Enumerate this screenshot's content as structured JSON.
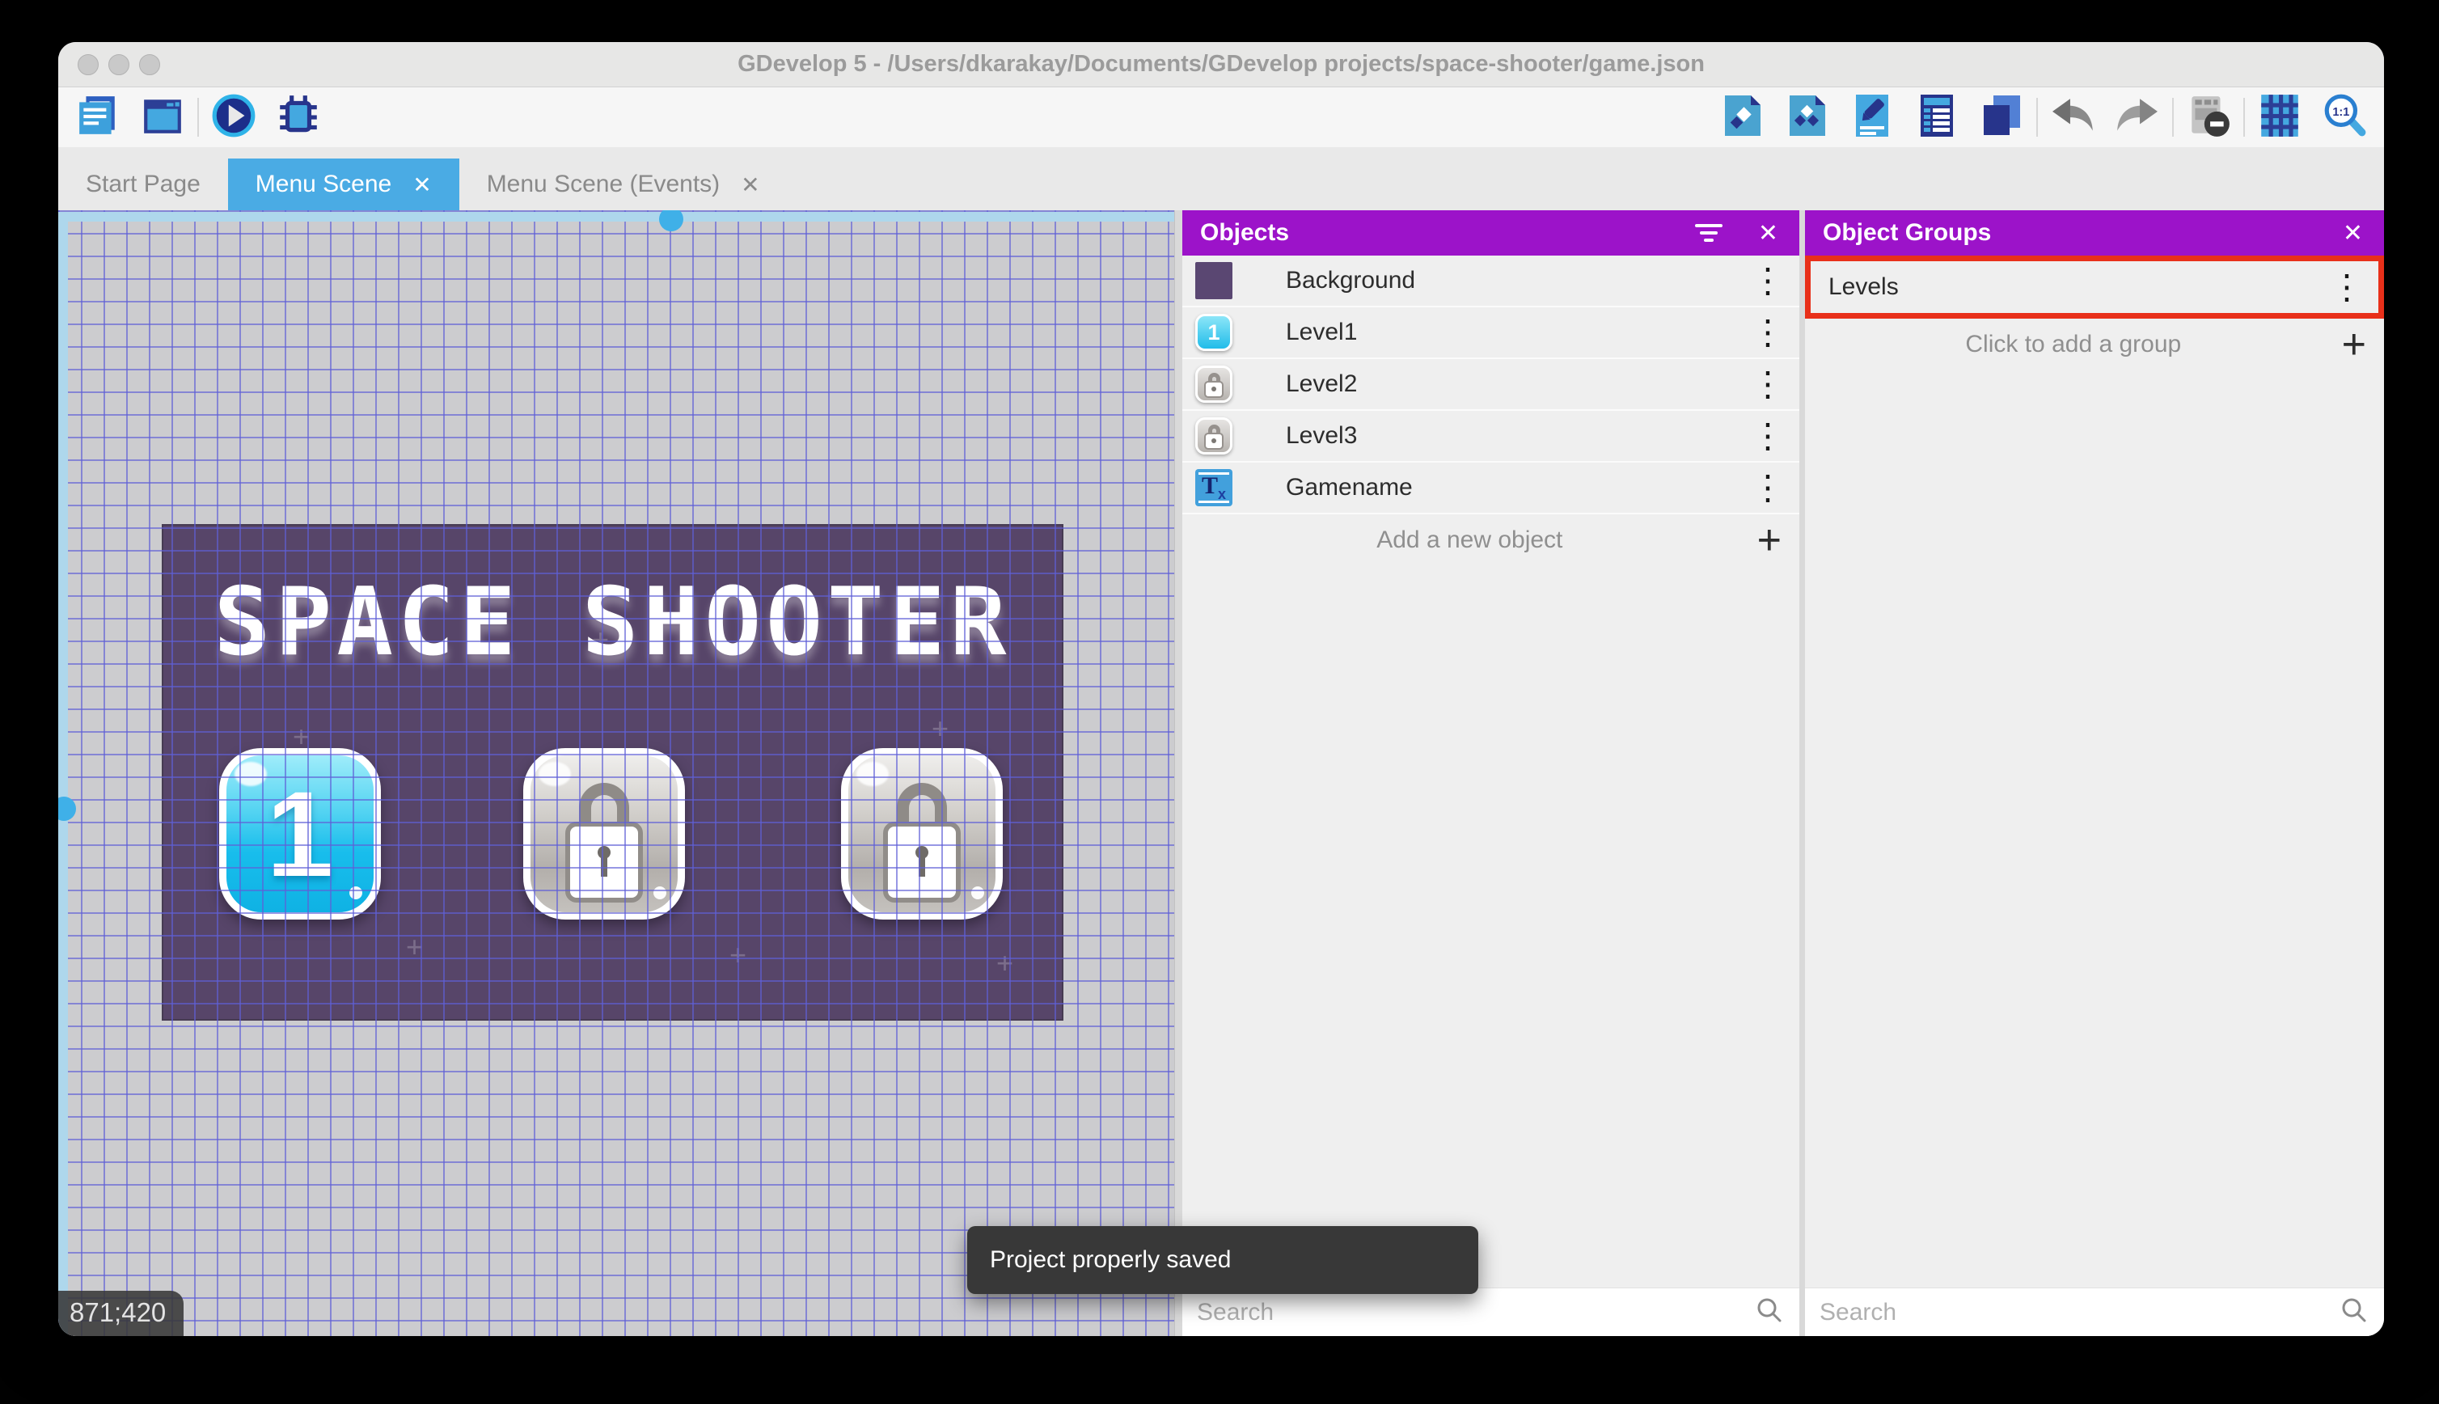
{
  "window": {
    "title": "GDevelop 5 - /Users/dkarakay/Documents/GDevelop projects/space-shooter/game.json"
  },
  "tabs": [
    {
      "label": "Start Page"
    },
    {
      "label": "Menu Scene"
    },
    {
      "label": "Menu Scene (Events)"
    }
  ],
  "canvas": {
    "game_title": "SPACE SHOOTER",
    "level_button_label": "1",
    "coordinates": "871;420"
  },
  "objects_panel": {
    "title": "Objects",
    "items": [
      {
        "name": "Background"
      },
      {
        "name": "Level1"
      },
      {
        "name": "Level2"
      },
      {
        "name": "Level3"
      },
      {
        "name": "Gamename"
      }
    ],
    "add_label": "Add a new object",
    "search_placeholder": "Search"
  },
  "groups_panel": {
    "title": "Object Groups",
    "items": [
      {
        "name": "Levels"
      }
    ],
    "add_label": "Click to add a group",
    "search_placeholder": "Search"
  },
  "toast": {
    "message": "Project properly saved"
  },
  "glyphs": {
    "close": "✕",
    "kebab": "⋮",
    "plus": "+",
    "sparkle": "+"
  },
  "colors": {
    "panel_header_purple": "#9c13c9",
    "active_tab_blue": "#4aabe4",
    "highlight_red": "#e8301a",
    "game_background_purple": "#574569",
    "level_button_blue": "#18bdec",
    "toast_background": "#383838"
  }
}
